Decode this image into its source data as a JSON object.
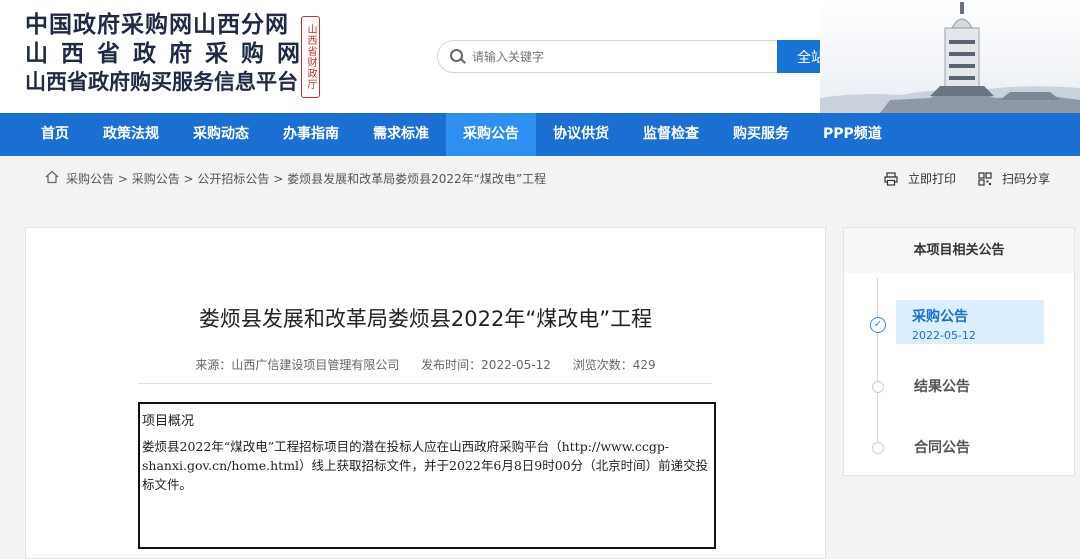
{
  "brand": {
    "line1": "中国政府采购网山西分网",
    "line2": "山西省政府采购网",
    "line3": "山西省政府购买服务信息平台",
    "seal": "山西省财政厅"
  },
  "search": {
    "placeholder": "请输入关键字",
    "button": "全站搜索"
  },
  "nav": {
    "items": [
      "首页",
      "政策法规",
      "采购动态",
      "办事指南",
      "需求标准",
      "采购公告",
      "协议供货",
      "监督检查",
      "购买服务",
      "PPP频道"
    ],
    "active_index": 5
  },
  "breadcrumb": {
    "items": [
      "采购公告",
      "采购公告",
      "公开招标公告",
      "娄烦县发展和改革局娄烦县2022年“煤改电”工程"
    ],
    "separator": " > "
  },
  "tools": {
    "print": "立即打印",
    "share": "扫码分享"
  },
  "article": {
    "title": "娄烦县发展和改革局娄烦县2022年“煤改电”工程",
    "source": "来源：山西广信建设项目管理有限公司",
    "published": "发布时间：2022-05-12",
    "views": "浏览次数：429",
    "summary_heading": "项目概况",
    "summary_text": "娄烦县2022年“煤改电”工程招标项目的潜在投标人应在山西政府采购平台（http://www.ccgp-shanxi.gov.cn/home.html）线上获取招标文件，并于2022年6月8日9时00分（北京时间）前递交投标文件。"
  },
  "sidebar": {
    "heading": "本项目相关公告",
    "items": [
      {
        "label": "采购公告",
        "date": "2022-05-12",
        "active": true
      },
      {
        "label": "结果公告",
        "date": "",
        "active": false
      },
      {
        "label": "合同公告",
        "date": "",
        "active": false
      }
    ]
  },
  "colors": {
    "nav_bg": "#1c6fd2",
    "nav_active": "#2f8ff0",
    "search_btn": "#1773d6",
    "seal_red": "#c9302c"
  }
}
